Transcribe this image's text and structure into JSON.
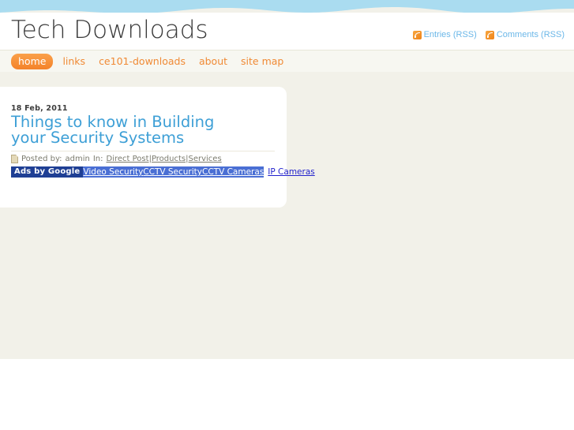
{
  "site": {
    "title": "Tech Downloads"
  },
  "feeds": [
    {
      "label": "Entries (RSS)",
      "icon": "rss-icon"
    },
    {
      "label": "Comments (RSS)",
      "icon": "rss-icon"
    }
  ],
  "nav": {
    "items": [
      {
        "label": "home",
        "active": true
      },
      {
        "label": "links",
        "active": false
      },
      {
        "label": "ce101-downloads",
        "active": false
      },
      {
        "label": "about",
        "active": false
      },
      {
        "label": "site map",
        "active": false
      }
    ]
  },
  "post": {
    "date": "18 Feb, 2011",
    "title": "Things to know in Building your Security Systems",
    "meta": {
      "posted_by_label": "Posted by:",
      "author": "admin",
      "in_label": "In:",
      "categories": [
        "Direct Post",
        "Products",
        "Services"
      ],
      "category_separator": "|"
    },
    "ads": {
      "badge": "Ads by Google",
      "links": [
        "Video Security",
        "CCTV Security",
        "CCTV Cameras",
        "IP Cameras"
      ]
    }
  },
  "colors": {
    "wave": "#aadcf0",
    "page_background": "#f2f1e9",
    "nav_background": "#f7f7f1",
    "accent_orange": "#f08a35",
    "title_blue": "#3d9fd6",
    "rss_blue": "#6bb7e8",
    "ads_badge_blue": "#1f3f94"
  }
}
